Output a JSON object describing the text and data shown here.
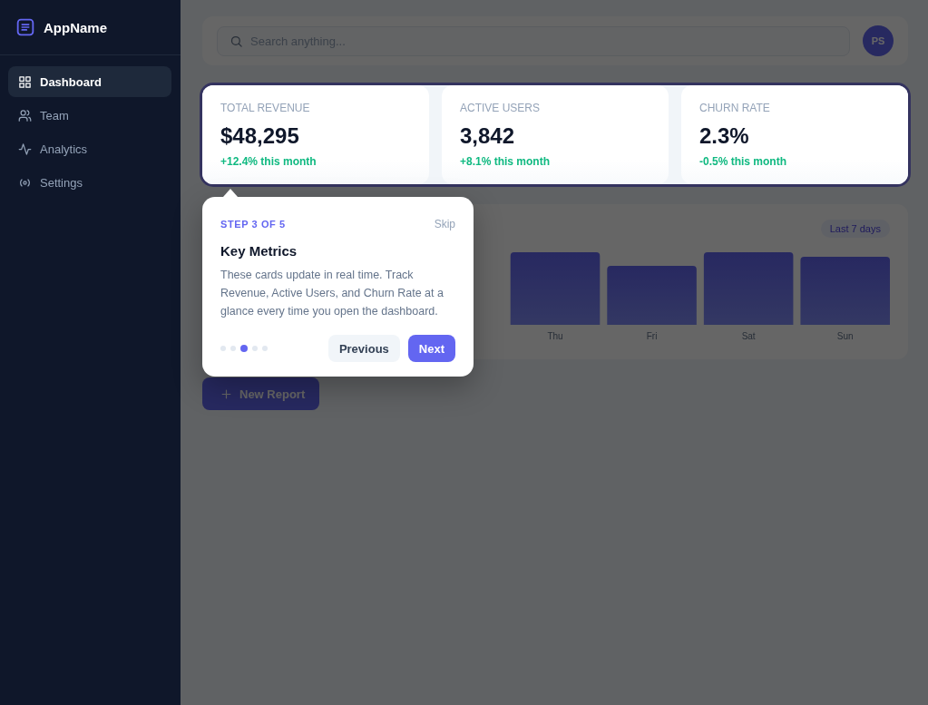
{
  "sidebar": {
    "brand": "AppName",
    "items": [
      {
        "label": "Dashboard",
        "selected": true
      },
      {
        "label": "Team",
        "selected": false
      },
      {
        "label": "Analytics",
        "selected": false
      },
      {
        "label": "Settings",
        "selected": false
      }
    ]
  },
  "topbar": {
    "search": {
      "placeholder": "Search anything..."
    },
    "avatar": "PS"
  },
  "stats": [
    {
      "label": "TOTAL REVENUE",
      "value": "$48,295",
      "change": "+12.4% this month"
    },
    {
      "label": "ACTIVE USERS",
      "value": "3,842",
      "change": "+8.1% this month"
    },
    {
      "label": "CHURN RATE",
      "value": "2.3%",
      "change": "-0.5% this month"
    }
  ],
  "chart": {
    "range": "Last 7 days",
    "day_labels": [
      "Thu",
      "Fri",
      "Sat",
      "Sun"
    ]
  },
  "actions": {
    "new_report": "New Report"
  },
  "tour": {
    "step": "STEP 3 OF 5",
    "skip": "Skip",
    "title": "Key Metrics",
    "body": "These cards update in real time. Track Revenue, Active Users, and Churn Rate at a glance every time you open the dashboard.",
    "steps": [
      {
        "selected": false
      },
      {
        "selected": false
      },
      {
        "selected": true
      },
      {
        "selected": false
      },
      {
        "selected": false
      }
    ],
    "buttons": [
      {
        "label": "Previous",
        "kind": "secondary"
      },
      {
        "label": "Next",
        "kind": "primary"
      }
    ]
  }
}
